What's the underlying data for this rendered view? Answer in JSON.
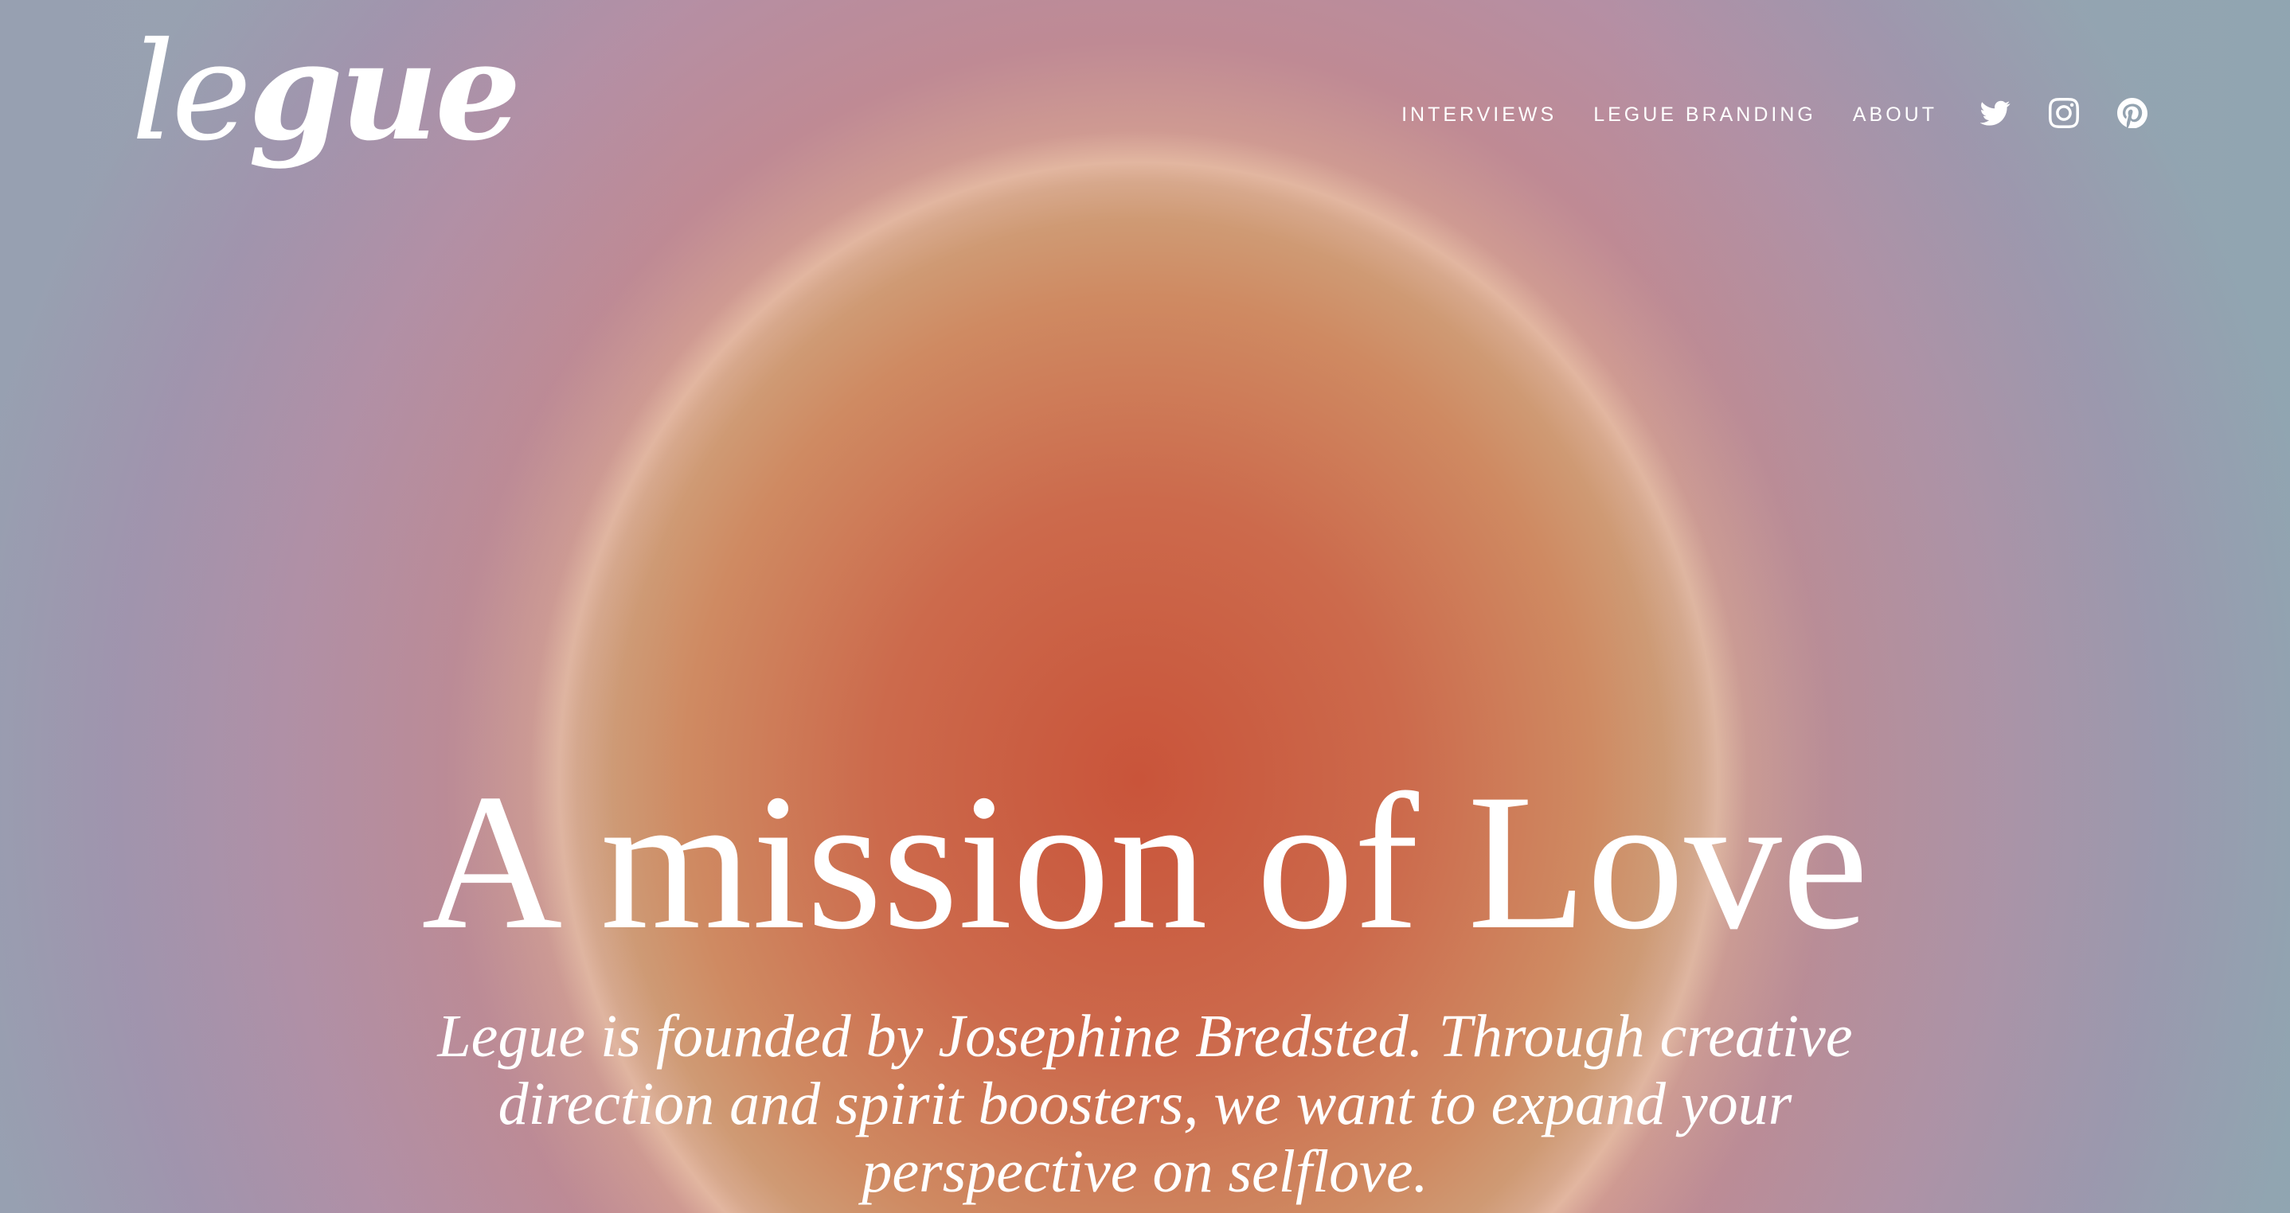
{
  "brand": {
    "logo_light": "le",
    "logo_bold": "gue"
  },
  "nav": {
    "items": [
      {
        "label": "INTERVIEWS"
      },
      {
        "label": "LEGUE BRANDING"
      },
      {
        "label": "ABOUT"
      }
    ],
    "social": [
      {
        "icon": "twitter-icon"
      },
      {
        "icon": "instagram-icon"
      },
      {
        "icon": "pinterest-icon"
      }
    ]
  },
  "hero": {
    "headline": "A mission of Love",
    "intro": "Legue is founded by Josephine Bredsted. Through creative direction and spirit boosters, we want to expand your perspective on selflove."
  },
  "colors": {
    "text": "#ffffff",
    "orb_center": "#c9543a",
    "orb_halo": "#e2b6a0",
    "background_edge": "#a494ac"
  }
}
